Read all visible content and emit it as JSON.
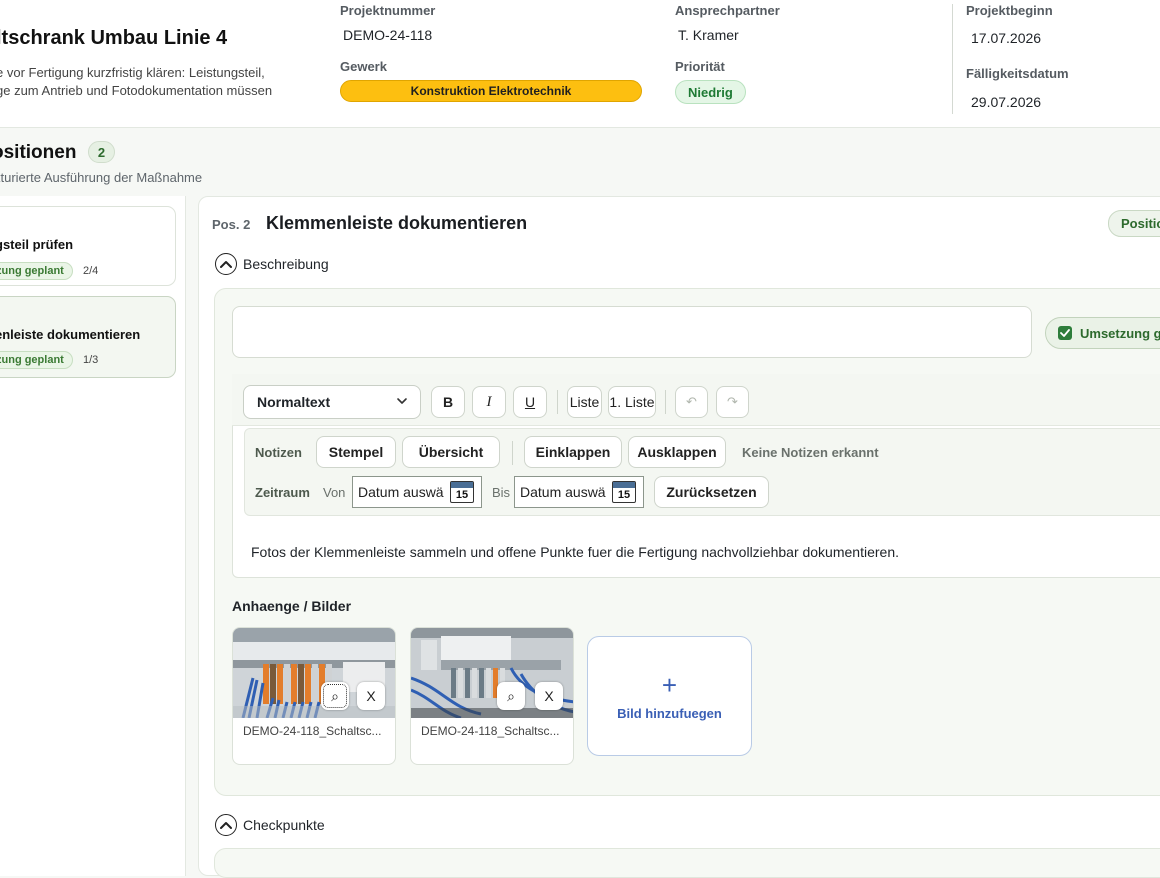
{
  "project": {
    "title": "ltschrank Umbau Linie 4",
    "description_lines": [
      "e vor Fertigung kurzfristig klären: Leistungsteil,",
      "ge zum Antrieb und Fotodokumentation müssen"
    ],
    "fields": {
      "projektnummer_label": "Projektnummer",
      "projektnummer": "DEMO-24-118",
      "gewerk_label": "Gewerk",
      "gewerk": "Konstruktion Elektrotechnik",
      "ansprechpartner_label": "Ansprechpartner",
      "ansprechpartner": "T. Kramer",
      "prioritaet_label": "Priorität",
      "prioritaet": "Niedrig",
      "projektbeginn_label": "Projektbeginn",
      "projektbeginn": "17.07.2026",
      "faelligkeit_label": "Fälligkeitsdatum",
      "faelligkeit": "29.07.2026"
    },
    "colors": {
      "gewerk": "#fdbf10",
      "priority": "#1e7a34"
    }
  },
  "positions_section": {
    "title": "ositionen",
    "count": "2",
    "subtitle": "kturierte Ausführung der Maßnahme",
    "items": [
      {
        "title": "gsteil prüfen",
        "status": "zung geplant",
        "progress": "2/4"
      },
      {
        "title": "enleiste dokumentieren",
        "status": "zung geplant",
        "progress": "1/3"
      }
    ]
  },
  "detail": {
    "pos_label": "Pos. 2",
    "title": "Klemmenleiste dokumentieren",
    "status_button": "Position",
    "beschreibung_label": "Beschreibung",
    "umsetzung_label": "Umsetzung g",
    "editor": {
      "format_select": "Normaltext",
      "bold": "B",
      "italic": "I",
      "underline": "U",
      "bullet_list": "Liste",
      "numbered_list": "1. Liste",
      "undo": "↶",
      "redo": "↷"
    },
    "notes": {
      "label": "Notizen",
      "stempel": "Stempel",
      "uebersicht": "Übersicht",
      "einklappen": "Einklappen",
      "ausklappen": "Ausklappen",
      "status": "Keine Notizen erkannt",
      "zeitraum_label": "Zeitraum",
      "von_label": "Von",
      "bis_label": "Bis",
      "date_placeholder": "Datum auswä",
      "calendar_day": "15",
      "reset": "Zurücksetzen"
    },
    "body_text": "Fotos der Klemmenleiste sammeln und offene Punkte fuer die Fertigung nachvollziehbar dokumentieren.",
    "attachments": {
      "title": "Anhaenge / Bilder",
      "files": [
        {
          "name": "DEMO-24-118_Schaltsc...",
          "zoom": "⌕",
          "remove": "X"
        },
        {
          "name": "DEMO-24-118_Schaltsc...",
          "zoom": "⌕",
          "remove": "X"
        }
      ],
      "add_plus": "+",
      "add_label": "Bild hinzufuegen"
    },
    "checkpunkte_label": "Checkpunkte"
  }
}
